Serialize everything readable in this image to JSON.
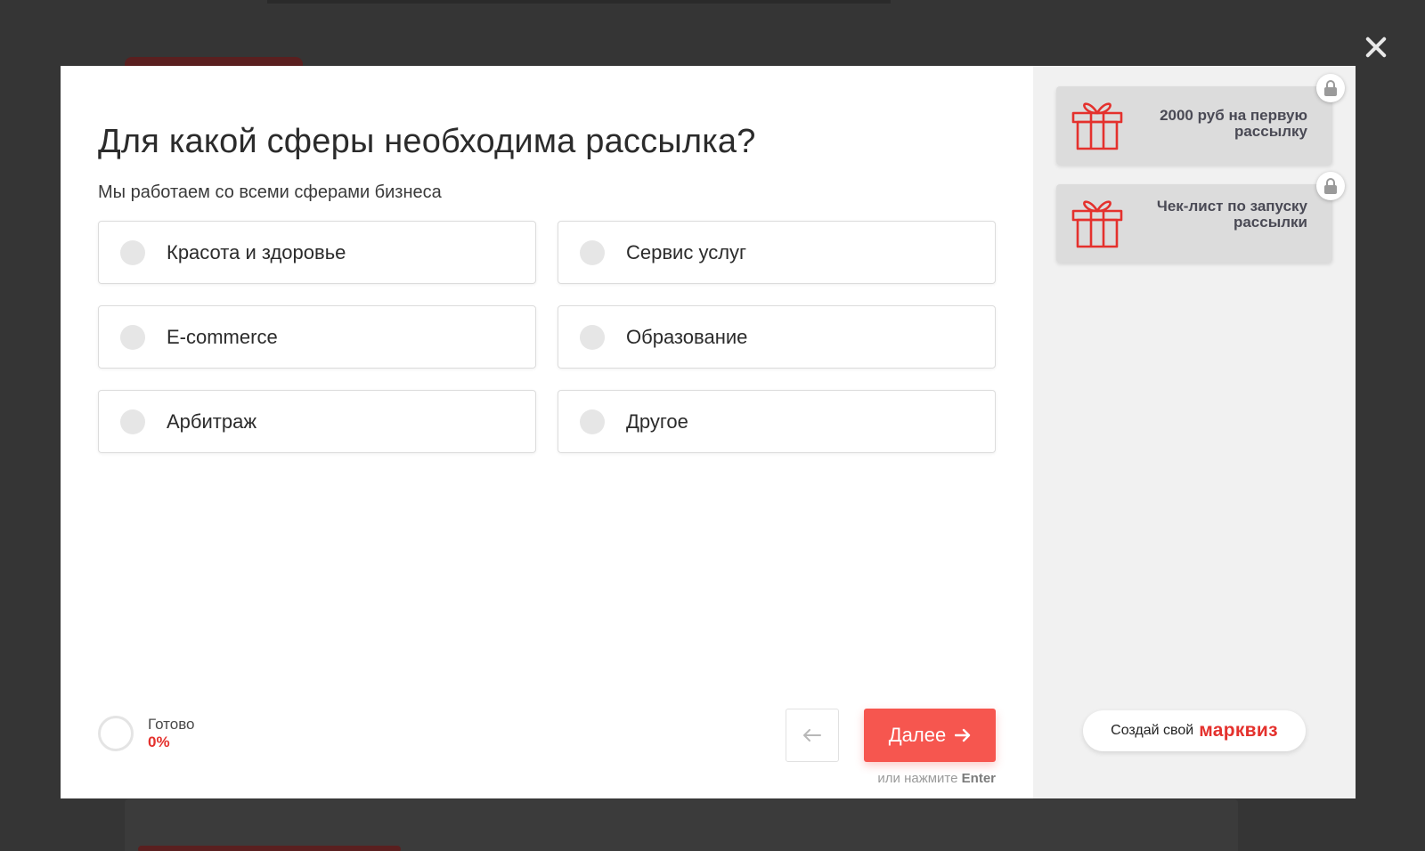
{
  "modal": {
    "title": "Для какой сферы необходима рассылка?",
    "subtitle": "Мы работаем со всеми сферами бизнеса",
    "options": [
      {
        "label": "Красота и здоровье"
      },
      {
        "label": "Сервис услуг"
      },
      {
        "label": "E-commerce"
      },
      {
        "label": "Образование"
      },
      {
        "label": "Арбитраж"
      },
      {
        "label": "Другое"
      }
    ],
    "progress": {
      "label": "Готово",
      "value": "0%"
    },
    "next_label": "Далее",
    "hint_prefix": "или нажмите",
    "hint_key": "Enter"
  },
  "sidebar": {
    "gifts": [
      {
        "text": "2000 руб на первую рассылку",
        "locked": true
      },
      {
        "text": "Чек-лист по запуску рассылки",
        "locked": true
      }
    ],
    "brand_prefix": "Создай свой",
    "brand_name": "марквиз"
  },
  "icons": {
    "close": "close-icon",
    "gift": "gift-icon",
    "lock": "lock-icon",
    "back": "arrow-left-icon",
    "next": "arrow-right-icon"
  },
  "colors": {
    "accent": "#f6564f",
    "brand": "#e4312d",
    "overlay": "#353535"
  }
}
